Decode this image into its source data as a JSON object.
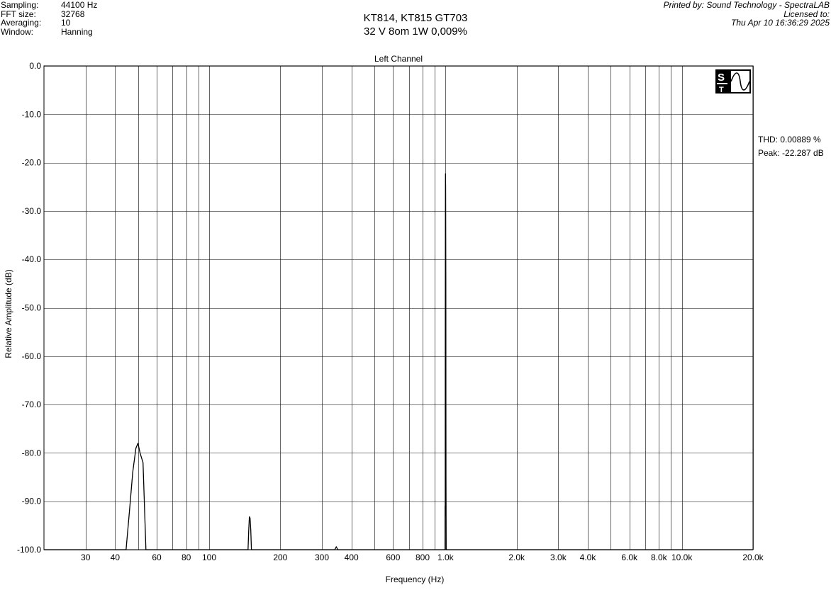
{
  "header": {
    "params": [
      {
        "label": "Sampling:",
        "value": "44100 Hz"
      },
      {
        "label": "FFT size:",
        "value": "32768"
      },
      {
        "label": "Averaging:",
        "value": "10"
      },
      {
        "label": "Window:",
        "value": "Hanning"
      }
    ],
    "title_line1": "KT814, KT815 GT703",
    "title_line2": "32 V 8om 1W 0,009%",
    "printed_by": "Printed by: Sound Technology - SpectraLAB",
    "licensed_to": "Licensed to:",
    "timestamp": "Thu Apr 10 16:36:29 2025"
  },
  "readout": {
    "thd": "THD: 0.00889 %",
    "peak": "Peak: -22.287 dB"
  },
  "logo": {
    "icon": "st-logo-icon"
  },
  "chart_data": {
    "type": "line",
    "title": "Left Channel",
    "xlabel": "Frequency (Hz)",
    "ylabel": "Relative Amplitude (dB)",
    "xscale": "log",
    "xlim": [
      20,
      20000
    ],
    "ylim": [
      -100,
      0
    ],
    "grid": true,
    "y_ticks": [
      0,
      -10,
      -20,
      -30,
      -40,
      -50,
      -60,
      -70,
      -80,
      -90,
      -100
    ],
    "y_tick_labels": [
      "0.0",
      "-10.0",
      "-20.0",
      "-30.0",
      "-40.0",
      "-50.0",
      "-60.0",
      "-70.0",
      "-80.0",
      "-90.0",
      "-100.0"
    ],
    "x_ticks": [
      30,
      40,
      60,
      80,
      100,
      200,
      300,
      400,
      600,
      800,
      1000,
      2000,
      3000,
      4000,
      6000,
      8000,
      10000,
      20000
    ],
    "x_tick_labels": [
      "30",
      "40",
      "60",
      "80",
      "100",
      "200",
      "300",
      "400",
      "600",
      "800",
      "1.0k",
      "2.0k",
      "3.0k",
      "4.0k",
      "6.0k",
      "8.0k",
      "10.0k",
      "20.0k"
    ],
    "x_grid": [
      30,
      40,
      50,
      60,
      70,
      80,
      90,
      100,
      200,
      300,
      400,
      500,
      600,
      700,
      800,
      900,
      1000,
      2000,
      3000,
      4000,
      5000,
      6000,
      7000,
      8000,
      9000,
      10000,
      20000
    ],
    "line_color": "#000000",
    "series": [
      {
        "x": [
          20,
          44.5,
          46,
          47.5,
          49,
          50,
          51,
          52.5,
          54,
          146,
          147,
          148,
          149,
          150,
          151,
          152,
          340,
          345,
          350,
          995,
          996,
          997,
          998,
          999,
          1000,
          1001,
          1002,
          1003,
          1004,
          1005,
          1006,
          1007,
          1008,
          20000
        ],
        "y": [
          -100,
          -100,
          -92,
          -84,
          -79,
          -78,
          -80,
          -82,
          -100,
          -100,
          -96,
          -93.2,
          -93.5,
          -96,
          -100,
          -100,
          -100,
          -99.4,
          -100,
          -100,
          -91,
          -93,
          -55,
          -30,
          -22.3,
          -25,
          -31,
          -45,
          -70,
          -85,
          -95,
          -100,
          -100,
          -100
        ]
      }
    ]
  }
}
